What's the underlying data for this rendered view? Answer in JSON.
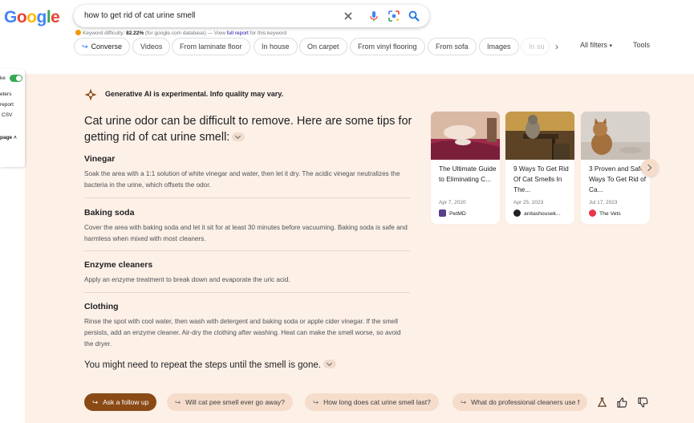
{
  "header": {
    "logo_text": "Google",
    "search_value": "how to get rid of cat urine smell",
    "keyword_difficulty": {
      "label": "Keyword difficulty:",
      "value": "82.22%",
      "db_note": "(for google.com database) — View",
      "link": "full report",
      "suffix": "for this keyword"
    }
  },
  "chips": {
    "items": [
      "Converse",
      "Videos",
      "From laminate floor",
      "In house",
      "On carpet",
      "From vinyl flooring",
      "From sofa",
      "Images",
      "In su"
    ],
    "all_filters": "All filters",
    "tools": "Tools"
  },
  "left_panel": {
    "items": [
      "ke",
      "eters",
      "report",
      "CSV",
      "page"
    ]
  },
  "ai_overview": {
    "notice": "Generative AI is experimental. Info quality may vary.",
    "headline": "Cat urine odor can be difficult to remove. Here are some tips for getting rid of cat urine smell:",
    "tips": [
      {
        "title": "Vinegar",
        "body": "Soak the area with a 1:1 solution of white vinegar and water, then let it dry. The acidic vinegar neutralizes the bacteria in the urine, which offsets the odor."
      },
      {
        "title": "Baking soda",
        "body": "Cover the area with baking soda and let it sit for at least 30 minutes before vacuuming. Baking soda is safe and harmless when mixed with most cleaners."
      },
      {
        "title": "Enzyme cleaners",
        "body": "Apply an enzyme treatment to break down and evaporate the uric acid."
      },
      {
        "title": "Clothing",
        "body": "Rinse the spot with cool water, then wash with detergent and baking soda or apple cider vinegar. If the smell persists, add an enzyme cleaner. Air-dry the clothing after washing. Heat can make the smell worse, so avoid the dryer."
      }
    ],
    "closing": "You might need to repeat the steps until the smell is gone.",
    "cards": [
      {
        "title": "The Ultimate Guide to Eliminating C...",
        "date": "Apr 7, 2020",
        "source": "PetMD",
        "favicon_color": "#5a3e8c"
      },
      {
        "title": "9 Ways To Get Rid Of Cat Smells In The...",
        "date": "Apr 25, 2023",
        "source": "anitashousek...",
        "favicon_color": "#202124"
      },
      {
        "title": "3 Proven and Safe Ways To Get Rid of Ca...",
        "date": "Jul 17, 2023",
        "source": "The Vets",
        "favicon_color": "#e8334a"
      }
    ],
    "followups": {
      "primary": "Ask a follow up",
      "items": [
        "Will cat pee smell ever go away?",
        "How long does cat urine smell last?",
        "What do professional cleaners use f"
      ]
    }
  },
  "colors": {
    "ai_background": "#fdf0e7",
    "followup_primary": "#8a4a16",
    "followup_chip": "#f6dccb",
    "link_blue": "#1a0dab",
    "toggle_green": "#34a853"
  }
}
